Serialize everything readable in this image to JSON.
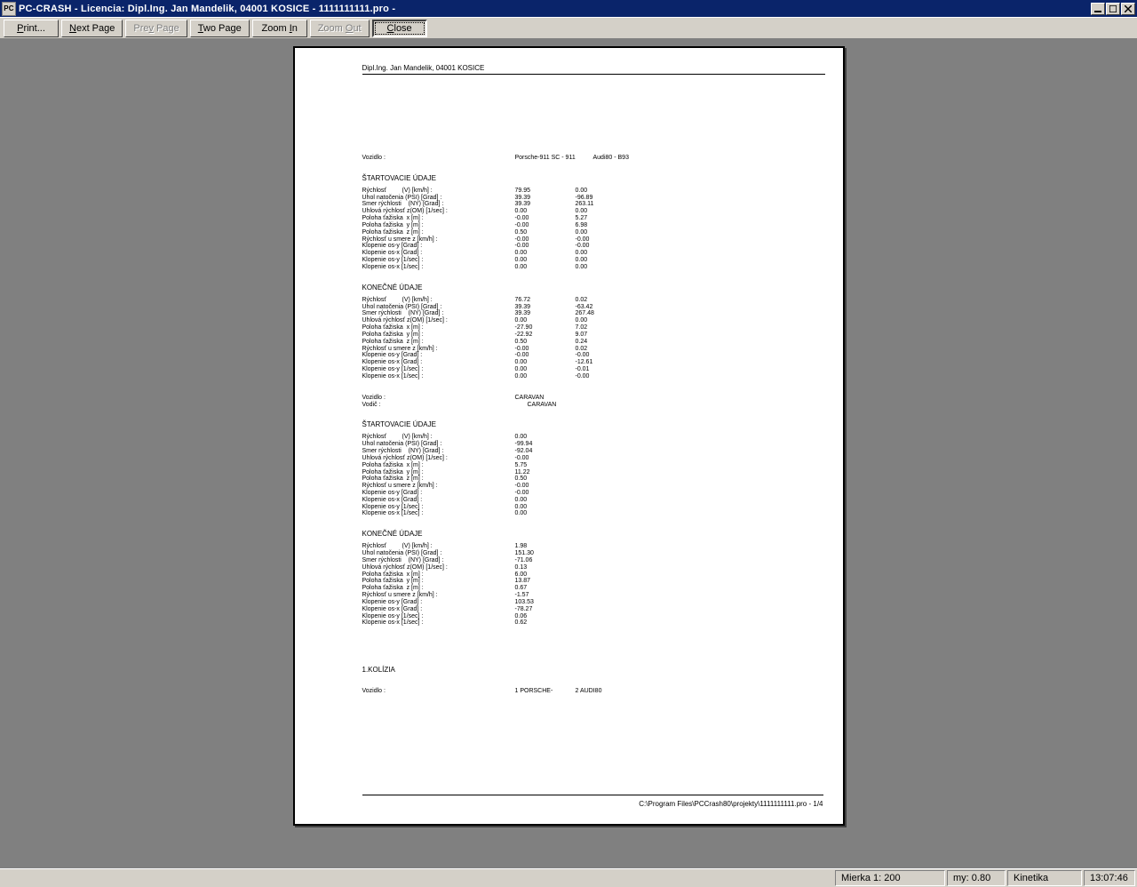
{
  "titlebar": {
    "text": "PC-CRASH - Licencia: Dipl.Ing. Jan Mandelik, 04001 KOSICE - 1111111111.pro -"
  },
  "toolbar": {
    "print": "Print...",
    "next": "Next Page",
    "prev": "Prev Page",
    "two": "Two Page",
    "zoomin": "Zoom In",
    "zoomout": "Zoom Out",
    "close": "Close"
  },
  "page": {
    "header_name": "Dipl.Ing. Jan Mandelik, 04001 KOSICE",
    "vozidlo_lbl": "Vozidlo :",
    "vodic_lbl": "Vodič :",
    "veh1": "Porsche-911 SC - 911",
    "veh2": "Audi80 - B93",
    "start_title": "ŠTARTOVACIE ÚDAJE",
    "end_title": "KONEČNÉ ÚDAJE",
    "labels": {
      "l1": "Rýchlosť         (V) [km/h] :",
      "l2": "Uhol natočenia (PSI) [Grad] :",
      "l3": "Smer rýchlosti    (NY) [Grad] :",
      "l4": "Uhlová rýchlosť z(OM) [1/sec] :",
      "l5": "Poloha ťažiska  x [m] :",
      "l6": "Poloha ťažiska  y [m] :",
      "l7": "Poloha ťažiska  z [m] :",
      "l8": "Rýchlosť u smere z [km/h] :",
      "l9": "Klopenie os-y [Grad] :",
      "l10": "Klopenie os-x [Grad] :",
      "l11": "Klopenie os-y [1/sec] :",
      "l12": "Klopenie os-x [1/sec] :"
    },
    "b1": {
      "r1": [
        "79.95",
        "0.00"
      ],
      "r2": [
        "39.39",
        "-96.89"
      ],
      "r3": [
        "39.39",
        "263.11"
      ],
      "r4": [
        "0.00",
        "0.00"
      ],
      "r5": [
        "-0.00",
        "5.27"
      ],
      "r6": [
        "-0.00",
        "6.98"
      ],
      "r7": [
        "0.50",
        "0.00"
      ],
      "r8": [
        "-0.00",
        "-0.00"
      ],
      "r9": [
        "-0.00",
        "-0.00"
      ],
      "r10": [
        "0.00",
        "0.00"
      ],
      "r11": [
        "0.00",
        "0.00"
      ],
      "r12": [
        "0.00",
        "0.00"
      ]
    },
    "b2": {
      "r1": [
        "76.72",
        "0.02"
      ],
      "r2": [
        "39.39",
        "-63.42"
      ],
      "r3": [
        "39.39",
        "267.48"
      ],
      "r4": [
        "0.00",
        "0.00"
      ],
      "r5": [
        "-27.90",
        "7.02"
      ],
      "r6": [
        "-22.92",
        "9.07"
      ],
      "r7": [
        "0.50",
        "0.24"
      ],
      "r8": [
        "-0.00",
        "0.02"
      ],
      "r9": [
        "-0.00",
        "-0.00"
      ],
      "r10": [
        "0.00",
        "-12.61"
      ],
      "r11": [
        "0.00",
        "-0.01"
      ],
      "r12": [
        "0.00",
        "-0.00"
      ]
    },
    "veh3": "CARAVAN",
    "veh3b": "CARAVAN",
    "b3": {
      "r1": [
        "0.00"
      ],
      "r2": [
        "-99.94"
      ],
      "r3": [
        "-92.04"
      ],
      "r4": [
        "-0.00"
      ],
      "r5": [
        "5.75"
      ],
      "r6": [
        "11.22"
      ],
      "r7": [
        "0.50"
      ],
      "r8": [
        "-0.00"
      ],
      "r9": [
        "-0.00"
      ],
      "r10": [
        "0.00"
      ],
      "r11": [
        "0.00"
      ],
      "r12": [
        "0.00"
      ]
    },
    "b4": {
      "r1": [
        "1.98"
      ],
      "r2": [
        "151.30"
      ],
      "r3": [
        "-71.06"
      ],
      "r4": [
        "0.13"
      ],
      "r5": [
        "6.00"
      ],
      "r6": [
        "13.87"
      ],
      "r7": [
        "0.67"
      ],
      "r8": [
        "-1.57"
      ],
      "r9": [
        "103.53"
      ],
      "r10": [
        "-78.27"
      ],
      "r11": [
        "0.06"
      ],
      "r12": [
        "0.62"
      ]
    },
    "kolizia": "1.KOLÍZIA",
    "kol_v1": "1 PORSCHE-",
    "kol_v2": "2 AUDI80",
    "footer": "C:\\Program Files\\PCCrash80\\projekty\\1111111111.pro - 1/4"
  },
  "status": {
    "scale": "Mierka 1: 200",
    "my": "my: 0.80",
    "mode": "Kinetika",
    "time": "13:07:46"
  }
}
